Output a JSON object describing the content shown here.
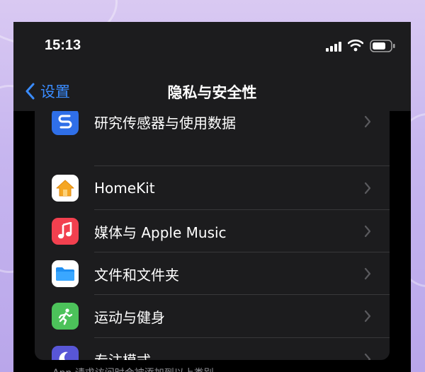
{
  "status_bar": {
    "time": "15:13",
    "signal_icon": "cellular-signal-icon",
    "wifi_icon": "wifi-icon",
    "battery_icon": "battery-icon"
  },
  "nav": {
    "back_label": "设置",
    "title": "隐私与安全性",
    "back_icon": "chevron-left-icon"
  },
  "colors": {
    "accent": "#3a8cff",
    "cell_background": "#1c1c1e",
    "separator": "#38383a"
  },
  "items": [
    {
      "label": "研究传感器与使用数据",
      "icon": "research-sensor-icon",
      "icon_color": "#2f6fe8"
    },
    {
      "label": "HomeKit",
      "icon": "home-icon",
      "icon_color": "#ffffff"
    },
    {
      "label": "媒体与 Apple Music",
      "icon": "music-note-icon",
      "icon_color": "#f2404f"
    },
    {
      "label": "文件和文件夹",
      "icon": "folder-icon",
      "icon_color": "#ffffff"
    },
    {
      "label": "运动与健身",
      "icon": "running-person-icon",
      "icon_color": "#4cc25a"
    },
    {
      "label": "专注模式",
      "icon": "moon-icon",
      "icon_color": "#5856d6"
    }
  ],
  "footer": {
    "text": "App 请求访问时会被添加到以上类别。"
  }
}
